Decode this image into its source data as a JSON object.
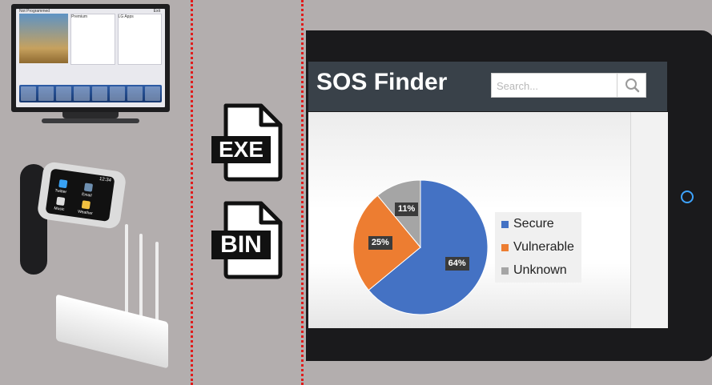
{
  "app": {
    "title": "SOS Finder",
    "search": {
      "placeholder": "Search...",
      "value": "",
      "button_icon": "magnifier-icon"
    }
  },
  "files": [
    {
      "label": "EXE",
      "icon": "exe-file-icon"
    },
    {
      "label": "BIN",
      "icon": "bin-file-icon"
    }
  ],
  "devices": {
    "tv_labels": {
      "program": "Not Programmed",
      "premium": "Premium",
      "lg_apps": "LG Apps",
      "exit": "Exit"
    },
    "watch_labels": {
      "time": "12:34",
      "twitter": "Twitter",
      "email": "Email",
      "music": "Music",
      "weather": "Weather"
    }
  },
  "chart_data": {
    "type": "pie",
    "labels": [
      "Secure",
      "Vulnerable",
      "Unknown"
    ],
    "values": [
      64,
      25,
      11
    ],
    "value_labels": [
      "64%",
      "25%",
      "11%"
    ],
    "colors": [
      "#4472c4",
      "#ed7d31",
      "#a5a5a5"
    ],
    "legend_position": "right"
  },
  "colors": {
    "header": "#394149",
    "divider": "#e01b1b",
    "tablet": "#1a1a1c",
    "home_button": "#3ea4ff"
  }
}
